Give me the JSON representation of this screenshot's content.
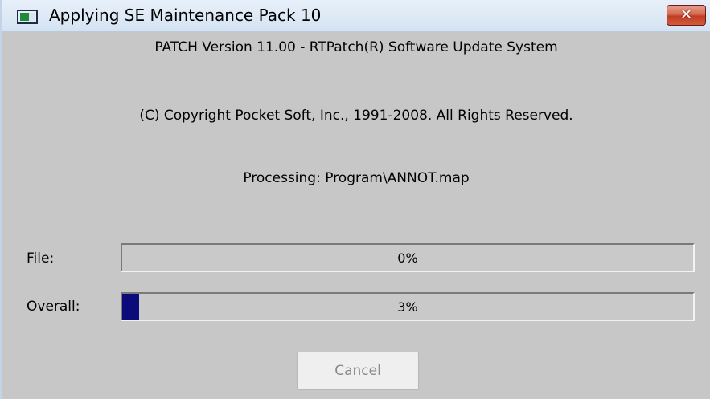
{
  "window": {
    "title": "Applying SE Maintenance Pack 10",
    "close_icon": "close-icon",
    "app_icon": "application-icon"
  },
  "content": {
    "version_line": "PATCH  Version 11.00 - RTPatch(R) Software Update System",
    "copyright_line": "(C) Copyright Pocket Soft, Inc., 1991-2008.  All Rights Reserved.",
    "processing_line": "Processing: Program\\ANNOT.map"
  },
  "progress": {
    "file": {
      "label": "File:",
      "percent": 0,
      "percent_text": "0%"
    },
    "overall": {
      "label": "Overall:",
      "percent": 3,
      "percent_text": "3%"
    }
  },
  "buttons": {
    "cancel_label": "Cancel",
    "cancel_enabled": false
  },
  "colors": {
    "progress_fill": "#0b0b7a",
    "window_background": "#c7c7c7",
    "close_button": "#c23e22"
  }
}
